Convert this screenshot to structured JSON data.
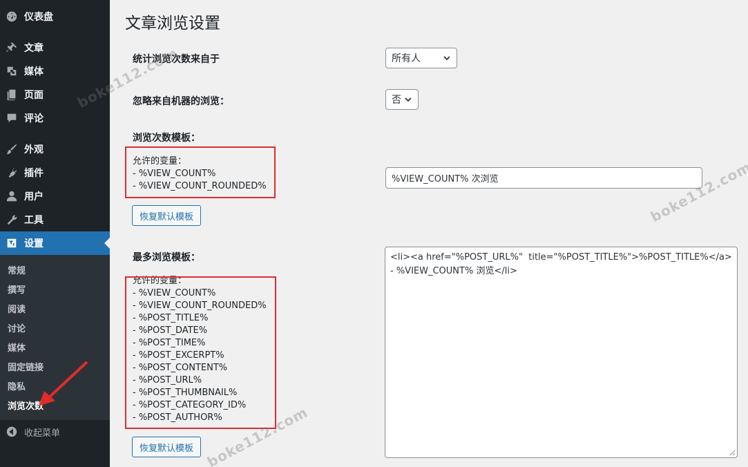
{
  "sidebar": {
    "items": [
      {
        "label": "仪表盘",
        "icon": "dashboard-icon"
      },
      {
        "label": "文章",
        "icon": "pin-icon"
      },
      {
        "label": "媒体",
        "icon": "media-icon"
      },
      {
        "label": "页面",
        "icon": "page-icon"
      },
      {
        "label": "评论",
        "icon": "comment-icon"
      },
      {
        "label": "外观",
        "icon": "brush-icon"
      },
      {
        "label": "插件",
        "icon": "plugin-icon"
      },
      {
        "label": "用户",
        "icon": "user-icon"
      },
      {
        "label": "工具",
        "icon": "wrench-icon"
      },
      {
        "label": "设置",
        "icon": "settings-icon"
      }
    ],
    "submenu": [
      "常规",
      "撰写",
      "阅读",
      "讨论",
      "媒体",
      "固定链接",
      "隐私",
      "浏览次数"
    ],
    "collapse_label": "收起菜单"
  },
  "main": {
    "title": "文章浏览设置",
    "count_from": {
      "label": "统计浏览次数来自于",
      "value": "所有人"
    },
    "ignore_bots": {
      "label": "忽略来自机器的浏览：",
      "value": "否"
    },
    "view_template": {
      "label": "浏览次数模板：",
      "vars_title": "允许的变量：",
      "vars": [
        "- %VIEW_COUNT%",
        "- %VIEW_COUNT_ROUNDED%"
      ],
      "input_value": "%VIEW_COUNT% 次浏览",
      "reset_label": "恢复默认模板"
    },
    "most_template": {
      "label": "最多浏览模板：",
      "vars_title": "允许的变量：",
      "vars": [
        "- %VIEW_COUNT%",
        "- %VIEW_COUNT_ROUNDED%",
        "- %POST_TITLE%",
        "- %POST_DATE%",
        "- %POST_TIME%",
        "- %POST_EXCERPT%",
        "- %POST_CONTENT%",
        "- %POST_URL%",
        "- %POST_THUMBNAIL%",
        "- %POST_CATEGORY_ID%",
        "- %POST_AUTHOR%"
      ],
      "textarea_value": "<li><a href=\"%POST_URL%\"  title=\"%POST_TITLE%\">%POST_TITLE%</a> - %VIEW_COUNT% 浏览</li>",
      "reset_label": "恢复默认模板"
    }
  },
  "watermark": "boke112.com",
  "colors": {
    "accent": "#2271b1",
    "highlight": "#e02b2b",
    "sidebar": "#1d2327"
  }
}
